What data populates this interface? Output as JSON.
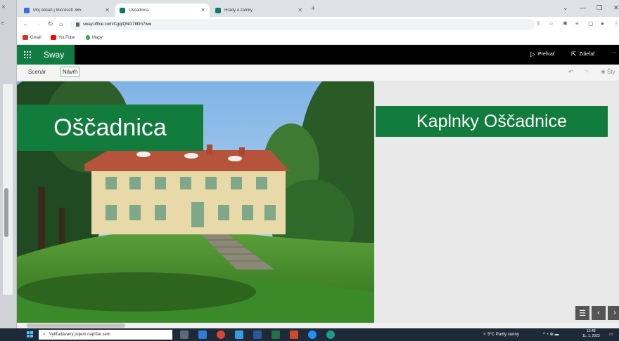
{
  "browser": {
    "tabs": [
      {
        "title": "Môj obsah | Microsoft 365",
        "active": false,
        "favicon_color": "#3b6fd8"
      },
      {
        "title": "Oščadnica",
        "active": true,
        "favicon_color": "#0f7a6b"
      },
      {
        "title": "Hrady a zámky",
        "active": false,
        "favicon_color": "#0f7a6b"
      }
    ],
    "new_tab_label": "+",
    "url": "sway.office.com/CgqIQNG78Ifm7ww",
    "bookmarks": [
      {
        "label": "Gmail",
        "color": "#d93025"
      },
      {
        "label": "YouTube",
        "color": "#ff0000"
      },
      {
        "label": "Mapy",
        "color": "#34a853"
      }
    ]
  },
  "sway": {
    "brand": "Sway",
    "play_label": "Prehrať",
    "share_label": "Zdieľať",
    "more_label": "···",
    "modes": [
      "Scenár",
      "Návrh"
    ],
    "selected_mode": "Návrh",
    "styles_label": "Šty",
    "accent_color": "#127c3d"
  },
  "content": {
    "title": "Oščadnica",
    "heading": "Kaplnky Oščadnice"
  },
  "taskbar": {
    "search_placeholder": "Vyhľadávaný pojem napíšte sem",
    "weather": "5°C  Partly sunny",
    "time": "15:48",
    "date": "11. 1. 2023"
  }
}
